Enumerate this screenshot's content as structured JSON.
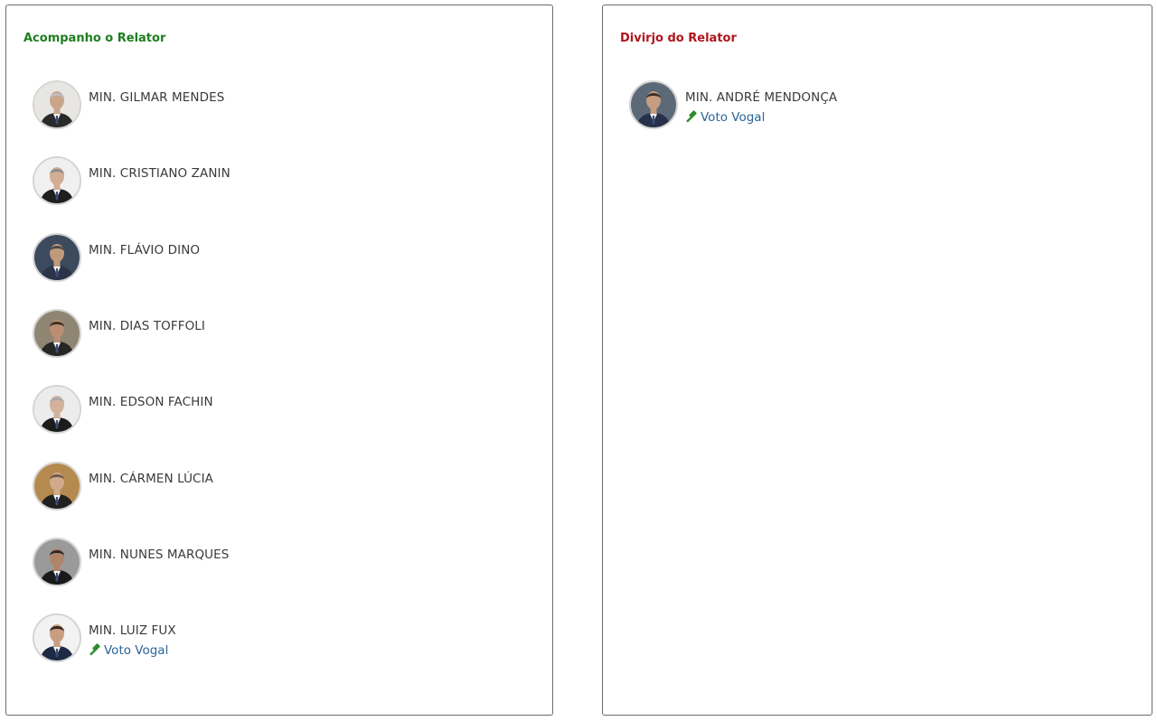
{
  "panels": {
    "follow": {
      "title": "Acompanho o Relator",
      "color": "#1e7e1e",
      "judges": [
        {
          "name": "MIN. GILMAR MENDES",
          "bg": "#e8e6e2",
          "suit": "#2a2a2a",
          "skin": "#c9a58a",
          "hair": "#bdbdbd"
        },
        {
          "name": "MIN. CRISTIANO ZANIN",
          "bg": "#f0f0f0",
          "suit": "#1f1f1f",
          "skin": "#d2ad95",
          "hair": "#8a8a8a"
        },
        {
          "name": "MIN. FLÁVIO DINO",
          "bg": "#3c4a5e",
          "suit": "#2b3448",
          "skin": "#c19a7c",
          "hair": "#4a4a4a"
        },
        {
          "name": "MIN. DIAS TOFFOLI",
          "bg": "#8e8672",
          "suit": "#262626",
          "skin": "#b98e73",
          "hair": "#3b2f28"
        },
        {
          "name": "MIN. EDSON FACHIN",
          "bg": "#ececec",
          "suit": "#1c1c1c",
          "skin": "#d3b29c",
          "hair": "#a9a9a9"
        },
        {
          "name": "MIN. CÁRMEN LÚCIA",
          "bg": "#b58a4e",
          "suit": "#202020",
          "skin": "#d1a98b",
          "hair": "#6b5a4a"
        },
        {
          "name": "MIN. NUNES MARQUES",
          "bg": "#9a9a9a",
          "suit": "#1a1a1a",
          "skin": "#b08468",
          "hair": "#2a2a2a"
        },
        {
          "name": "MIN. LUIZ FUX",
          "bg": "#f2f2f2",
          "suit": "#1d2a44",
          "skin": "#c99e80",
          "hair": "#2f2622",
          "vote": "Voto Vogal"
        }
      ]
    },
    "diverge": {
      "title": "Divirjo do Relator",
      "color": "#b0141c",
      "judges": [
        {
          "name": "MIN. ANDRÉ MENDONÇA",
          "bg": "#5c6a78",
          "suit": "#26304a",
          "skin": "#c79d80",
          "hair": "#3a302a",
          "vote": "Voto Vogal"
        }
      ]
    }
  },
  "icons": {
    "gavel": "gavel-icon",
    "link_color": "#2a6496",
    "gavel_color": "#2e8b2e"
  }
}
